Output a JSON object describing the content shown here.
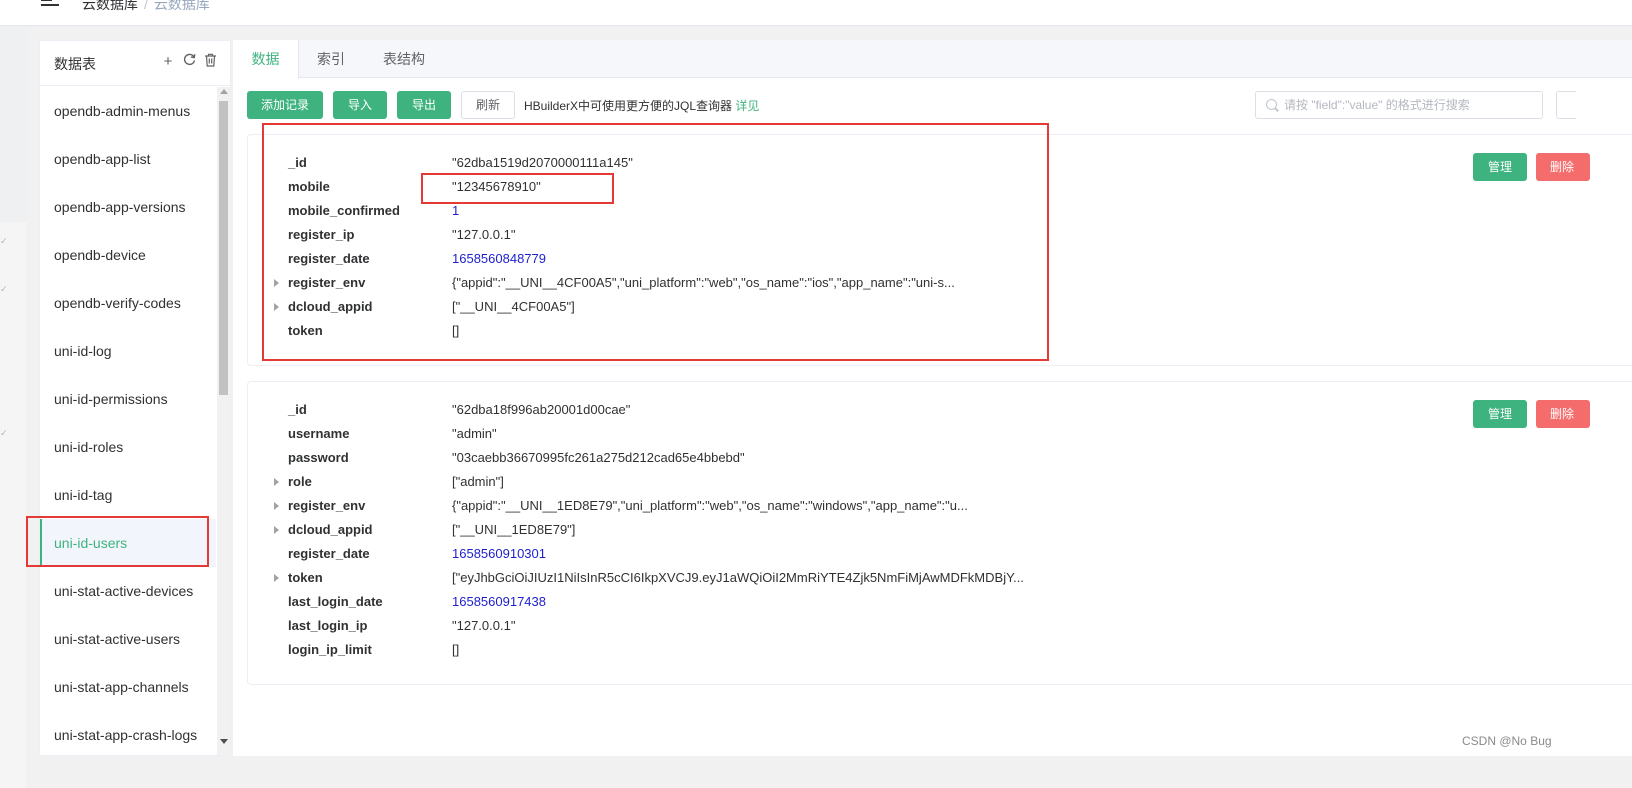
{
  "header": {
    "breadcrumb": [
      "云数据库",
      "云数据库"
    ],
    "separator": "/"
  },
  "tables_panel": {
    "title": "数据表",
    "icons": [
      "plus-icon",
      "refresh-icon",
      "trash-icon"
    ],
    "items": [
      "opendb-admin-menus",
      "opendb-app-list",
      "opendb-app-versions",
      "opendb-device",
      "opendb-verify-codes",
      "uni-id-log",
      "uni-id-permissions",
      "uni-id-roles",
      "uni-id-tag",
      "uni-id-users",
      "uni-stat-active-devices",
      "uni-stat-active-users",
      "uni-stat-app-channels",
      "uni-stat-app-crash-logs"
    ],
    "active_item": "uni-id-users"
  },
  "tabs": [
    "数据",
    "索引",
    "表结构"
  ],
  "active_tab": "数据",
  "toolbar": {
    "add_label": "添加记录",
    "import_label": "导入",
    "export_label": "导出",
    "refresh_label": "刷新",
    "tip_text": "HBuilderX中可使用更方便的JQL查询器",
    "tip_link": "详见",
    "search_placeholder": "请按 \"field\":\"value\" 的格式进行搜索"
  },
  "records": [
    {
      "manage_label": "管理",
      "delete_label": "删除",
      "fields": [
        {
          "key": "_id",
          "value": "\"62dba1519d2070000111a145\"",
          "type": "string",
          "expandable": false
        },
        {
          "key": "mobile",
          "value": "\"12345678910\"",
          "type": "string",
          "expandable": false
        },
        {
          "key": "mobile_confirmed",
          "value": "1",
          "type": "number",
          "expandable": false
        },
        {
          "key": "register_ip",
          "value": "\"127.0.0.1\"",
          "type": "string",
          "expandable": false
        },
        {
          "key": "register_date",
          "value": "1658560848779",
          "type": "number",
          "expandable": false
        },
        {
          "key": "register_env",
          "value": "{\"appid\":\"__UNI__4CF00A5\",\"uni_platform\":\"web\",\"os_name\":\"ios\",\"app_name\":\"uni-s...",
          "type": "object",
          "expandable": true
        },
        {
          "key": "dcloud_appid",
          "value": "[\"__UNI__4CF00A5\"]",
          "type": "array",
          "expandable": true
        },
        {
          "key": "token",
          "value": "[]",
          "type": "array",
          "expandable": false
        }
      ]
    },
    {
      "manage_label": "管理",
      "delete_label": "删除",
      "fields": [
        {
          "key": "_id",
          "value": "\"62dba18f996ab20001d00cae\"",
          "type": "string",
          "expandable": false
        },
        {
          "key": "username",
          "value": "\"admin\"",
          "type": "string",
          "expandable": false
        },
        {
          "key": "password",
          "value": "\"03caebb36670995fc261a275d212cad65e4bbebd\"",
          "type": "string",
          "expandable": false
        },
        {
          "key": "role",
          "value": "[\"admin\"]",
          "type": "array",
          "expandable": true
        },
        {
          "key": "register_env",
          "value": "{\"appid\":\"__UNI__1ED8E79\",\"uni_platform\":\"web\",\"os_name\":\"windows\",\"app_name\":\"u...",
          "type": "object",
          "expandable": true
        },
        {
          "key": "dcloud_appid",
          "value": "[\"__UNI__1ED8E79\"]",
          "type": "array",
          "expandable": true
        },
        {
          "key": "register_date",
          "value": "1658560910301",
          "type": "number",
          "expandable": false
        },
        {
          "key": "token",
          "value": "[\"eyJhbGciOiJIUzI1NiIsInR5cCI6IkpXVCJ9.eyJ1aWQiOiI2MmRiYTE4Zjk5NmFiMjAwMDFkMDBjY...",
          "type": "array",
          "expandable": true
        },
        {
          "key": "last_login_date",
          "value": "1658560917438",
          "type": "number",
          "expandable": false
        },
        {
          "key": "last_login_ip",
          "value": "\"127.0.0.1\"",
          "type": "string",
          "expandable": false
        },
        {
          "key": "login_ip_limit",
          "value": "[]",
          "type": "array",
          "expandable": false
        }
      ]
    }
  ],
  "watermark": "CSDN @No  Bug",
  "colors": {
    "accent": "#3fb37f",
    "danger": "#f56c6c",
    "number": "#1e1ecf",
    "annotation": "#e53935"
  }
}
